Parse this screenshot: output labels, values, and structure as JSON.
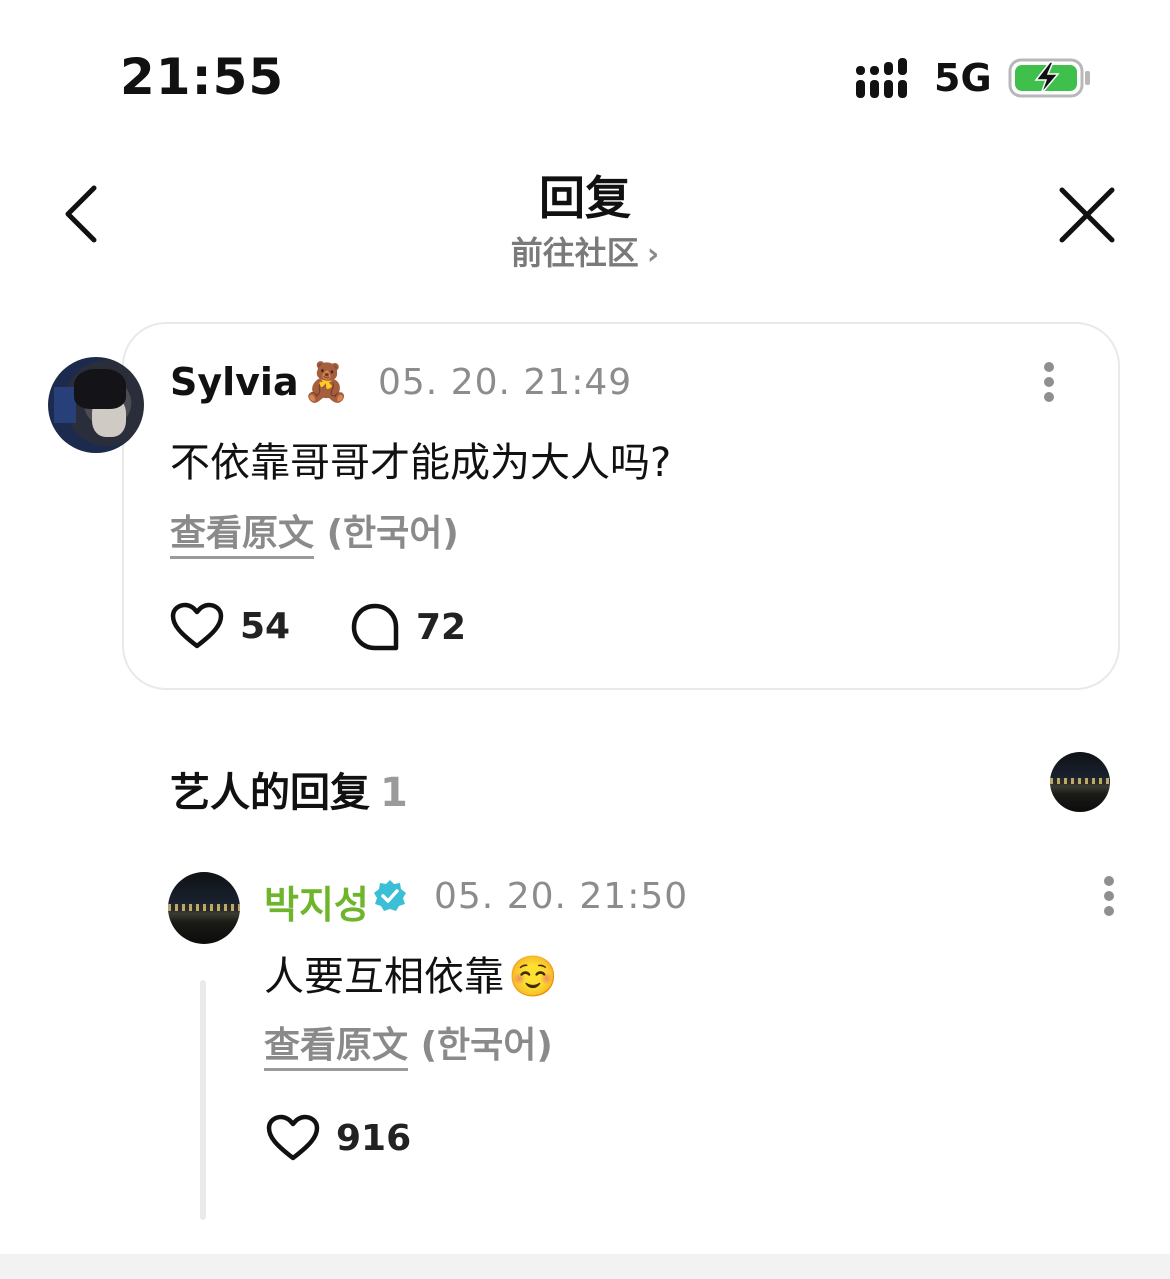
{
  "status_bar": {
    "time": "21:55",
    "network": "5G"
  },
  "header": {
    "title": "回复",
    "subtitle": "前往社区",
    "subtitle_chevron": "›"
  },
  "post": {
    "username": "Sylvia",
    "username_emoji": "🧸",
    "timestamp": "05. 20. 21:49",
    "text": "不依靠哥哥才能成为大人吗?",
    "translate_link": "查看原文",
    "translate_lang": "(한국어)",
    "likes": "54",
    "replies": "72"
  },
  "artist_replies": {
    "title": "艺人的回复",
    "count": "1",
    "reply": {
      "username": "박지성",
      "timestamp": "05. 20. 21:50",
      "text": "人要互相依靠",
      "text_emoji": "☺️",
      "translate_link": "查看原文",
      "translate_lang": "(한국어)",
      "likes": "916"
    }
  },
  "colors": {
    "artist_name": "#6fb52c",
    "verified_badge": "#3bbfd6",
    "battery_fill": "#3fc04d",
    "muted_text": "#8c8c8c"
  },
  "icons": [
    "signal-icon",
    "battery-charging-icon",
    "back-icon",
    "close-icon",
    "more-icon",
    "heart-icon",
    "comment-icon",
    "verified-badge-icon"
  ]
}
